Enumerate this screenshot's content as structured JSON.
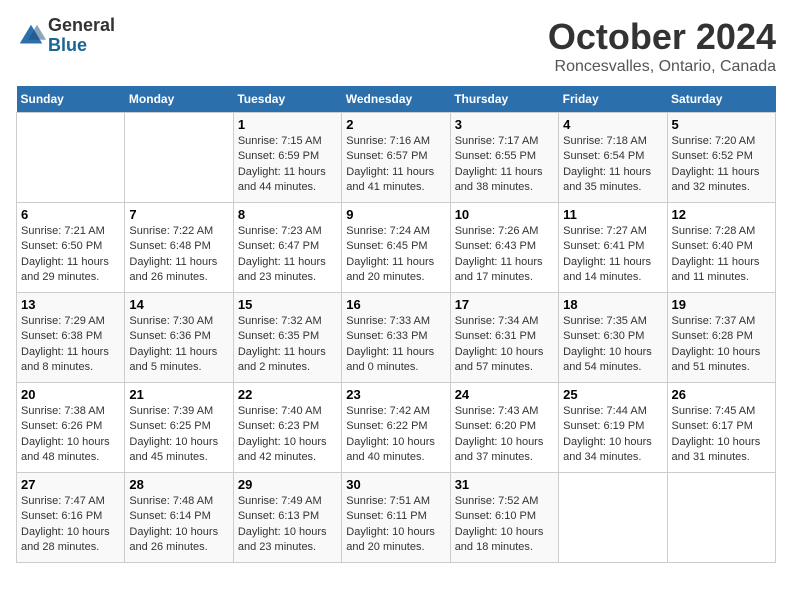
{
  "header": {
    "logo_general": "General",
    "logo_blue": "Blue",
    "title": "October 2024",
    "location": "Roncesvalles, Ontario, Canada"
  },
  "weekdays": [
    "Sunday",
    "Monday",
    "Tuesday",
    "Wednesday",
    "Thursday",
    "Friday",
    "Saturday"
  ],
  "weeks": [
    [
      {
        "day": "",
        "info": ""
      },
      {
        "day": "",
        "info": ""
      },
      {
        "day": "1",
        "info": "Sunrise: 7:15 AM\nSunset: 6:59 PM\nDaylight: 11 hours and 44 minutes."
      },
      {
        "day": "2",
        "info": "Sunrise: 7:16 AM\nSunset: 6:57 PM\nDaylight: 11 hours and 41 minutes."
      },
      {
        "day": "3",
        "info": "Sunrise: 7:17 AM\nSunset: 6:55 PM\nDaylight: 11 hours and 38 minutes."
      },
      {
        "day": "4",
        "info": "Sunrise: 7:18 AM\nSunset: 6:54 PM\nDaylight: 11 hours and 35 minutes."
      },
      {
        "day": "5",
        "info": "Sunrise: 7:20 AM\nSunset: 6:52 PM\nDaylight: 11 hours and 32 minutes."
      }
    ],
    [
      {
        "day": "6",
        "info": "Sunrise: 7:21 AM\nSunset: 6:50 PM\nDaylight: 11 hours and 29 minutes."
      },
      {
        "day": "7",
        "info": "Sunrise: 7:22 AM\nSunset: 6:48 PM\nDaylight: 11 hours and 26 minutes."
      },
      {
        "day": "8",
        "info": "Sunrise: 7:23 AM\nSunset: 6:47 PM\nDaylight: 11 hours and 23 minutes."
      },
      {
        "day": "9",
        "info": "Sunrise: 7:24 AM\nSunset: 6:45 PM\nDaylight: 11 hours and 20 minutes."
      },
      {
        "day": "10",
        "info": "Sunrise: 7:26 AM\nSunset: 6:43 PM\nDaylight: 11 hours and 17 minutes."
      },
      {
        "day": "11",
        "info": "Sunrise: 7:27 AM\nSunset: 6:41 PM\nDaylight: 11 hours and 14 minutes."
      },
      {
        "day": "12",
        "info": "Sunrise: 7:28 AM\nSunset: 6:40 PM\nDaylight: 11 hours and 11 minutes."
      }
    ],
    [
      {
        "day": "13",
        "info": "Sunrise: 7:29 AM\nSunset: 6:38 PM\nDaylight: 11 hours and 8 minutes."
      },
      {
        "day": "14",
        "info": "Sunrise: 7:30 AM\nSunset: 6:36 PM\nDaylight: 11 hours and 5 minutes."
      },
      {
        "day": "15",
        "info": "Sunrise: 7:32 AM\nSunset: 6:35 PM\nDaylight: 11 hours and 2 minutes."
      },
      {
        "day": "16",
        "info": "Sunrise: 7:33 AM\nSunset: 6:33 PM\nDaylight: 11 hours and 0 minutes."
      },
      {
        "day": "17",
        "info": "Sunrise: 7:34 AM\nSunset: 6:31 PM\nDaylight: 10 hours and 57 minutes."
      },
      {
        "day": "18",
        "info": "Sunrise: 7:35 AM\nSunset: 6:30 PM\nDaylight: 10 hours and 54 minutes."
      },
      {
        "day": "19",
        "info": "Sunrise: 7:37 AM\nSunset: 6:28 PM\nDaylight: 10 hours and 51 minutes."
      }
    ],
    [
      {
        "day": "20",
        "info": "Sunrise: 7:38 AM\nSunset: 6:26 PM\nDaylight: 10 hours and 48 minutes."
      },
      {
        "day": "21",
        "info": "Sunrise: 7:39 AM\nSunset: 6:25 PM\nDaylight: 10 hours and 45 minutes."
      },
      {
        "day": "22",
        "info": "Sunrise: 7:40 AM\nSunset: 6:23 PM\nDaylight: 10 hours and 42 minutes."
      },
      {
        "day": "23",
        "info": "Sunrise: 7:42 AM\nSunset: 6:22 PM\nDaylight: 10 hours and 40 minutes."
      },
      {
        "day": "24",
        "info": "Sunrise: 7:43 AM\nSunset: 6:20 PM\nDaylight: 10 hours and 37 minutes."
      },
      {
        "day": "25",
        "info": "Sunrise: 7:44 AM\nSunset: 6:19 PM\nDaylight: 10 hours and 34 minutes."
      },
      {
        "day": "26",
        "info": "Sunrise: 7:45 AM\nSunset: 6:17 PM\nDaylight: 10 hours and 31 minutes."
      }
    ],
    [
      {
        "day": "27",
        "info": "Sunrise: 7:47 AM\nSunset: 6:16 PM\nDaylight: 10 hours and 28 minutes."
      },
      {
        "day": "28",
        "info": "Sunrise: 7:48 AM\nSunset: 6:14 PM\nDaylight: 10 hours and 26 minutes."
      },
      {
        "day": "29",
        "info": "Sunrise: 7:49 AM\nSunset: 6:13 PM\nDaylight: 10 hours and 23 minutes."
      },
      {
        "day": "30",
        "info": "Sunrise: 7:51 AM\nSunset: 6:11 PM\nDaylight: 10 hours and 20 minutes."
      },
      {
        "day": "31",
        "info": "Sunrise: 7:52 AM\nSunset: 6:10 PM\nDaylight: 10 hours and 18 minutes."
      },
      {
        "day": "",
        "info": ""
      },
      {
        "day": "",
        "info": ""
      }
    ]
  ]
}
